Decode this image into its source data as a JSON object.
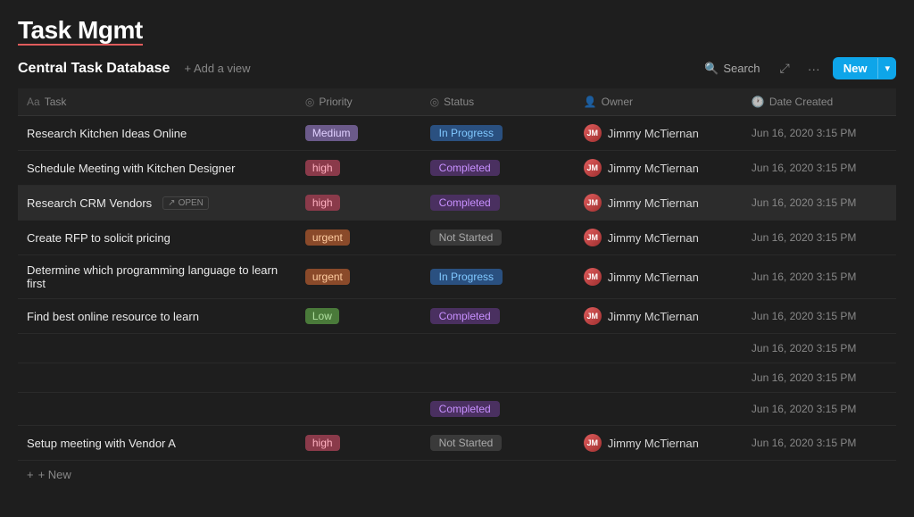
{
  "app": {
    "title": "Task Mgmt"
  },
  "toolbar": {
    "db_title": "Central Task Database",
    "add_view_label": "+ Add a view",
    "search_label": "Search",
    "new_label": "New",
    "expand_icon": "⤢",
    "more_icon": "···",
    "chevron_icon": "▾"
  },
  "table": {
    "columns": [
      {
        "id": "task",
        "icon": "Aa",
        "label": "Task"
      },
      {
        "id": "priority",
        "icon": "◎",
        "label": "Priority"
      },
      {
        "id": "status",
        "icon": "◎",
        "label": "Status"
      },
      {
        "id": "owner",
        "icon": "👤",
        "label": "Owner"
      },
      {
        "id": "date_created",
        "icon": "🕐",
        "label": "Date Created"
      }
    ],
    "rows": [
      {
        "id": 1,
        "task": "Research Kitchen Ideas Online",
        "show_open": false,
        "priority": "Medium",
        "priority_class": "priority-medium",
        "status": "In Progress",
        "status_class": "status-inprogress",
        "owner": "Jimmy McTiernan",
        "date": "Jun 16, 2020 3:15 PM"
      },
      {
        "id": 2,
        "task": "Schedule Meeting with Kitchen Designer",
        "show_open": false,
        "priority": "high",
        "priority_class": "priority-high",
        "status": "Completed",
        "status_class": "status-completed",
        "owner": "Jimmy McTiernan",
        "date": "Jun 16, 2020 3:15 PM"
      },
      {
        "id": 3,
        "task": "Research CRM Vendors",
        "show_open": true,
        "priority": "high",
        "priority_class": "priority-high",
        "status": "Completed",
        "status_class": "status-completed",
        "owner": "Jimmy McTiernan",
        "date": "Jun 16, 2020 3:15 PM"
      },
      {
        "id": 4,
        "task": "Create RFP to solicit pricing",
        "show_open": false,
        "priority": "urgent",
        "priority_class": "priority-urgent",
        "status": "Not Started",
        "status_class": "status-notstarted",
        "owner": "Jimmy McTiernan",
        "date": "Jun 16, 2020 3:15 PM"
      },
      {
        "id": 5,
        "task": "Determine which programming language to learn first",
        "show_open": false,
        "priority": "urgent",
        "priority_class": "priority-urgent",
        "status": "In Progress",
        "status_class": "status-inprogress",
        "owner": "Jimmy McTiernan",
        "date": "Jun 16, 2020 3:15 PM"
      },
      {
        "id": 6,
        "task": "Find best online resource to learn",
        "show_open": false,
        "priority": "Low",
        "priority_class": "priority-low",
        "status": "Completed",
        "status_class": "status-completed",
        "owner": "Jimmy McTiernan",
        "date": "Jun 16, 2020 3:15 PM"
      },
      {
        "id": 7,
        "task": "",
        "show_open": false,
        "priority": "",
        "priority_class": "",
        "status": "",
        "status_class": "",
        "owner": "",
        "date": "Jun 16, 2020 3:15 PM"
      },
      {
        "id": 8,
        "task": "",
        "show_open": false,
        "priority": "",
        "priority_class": "",
        "status": "",
        "status_class": "",
        "owner": "",
        "date": "Jun 16, 2020 3:15 PM"
      },
      {
        "id": 9,
        "task": "",
        "show_open": false,
        "priority": "",
        "priority_class": "",
        "status": "Completed",
        "status_class": "status-completed",
        "owner": "",
        "date": "Jun 16, 2020 3:15 PM"
      },
      {
        "id": 10,
        "task": "Setup meeting with Vendor A",
        "show_open": false,
        "priority": "high",
        "priority_class": "priority-high",
        "status": "Not Started",
        "status_class": "status-notstarted",
        "owner": "Jimmy McTiernan",
        "date": "Jun 16, 2020 3:15 PM"
      }
    ],
    "add_row_label": "+ New"
  }
}
